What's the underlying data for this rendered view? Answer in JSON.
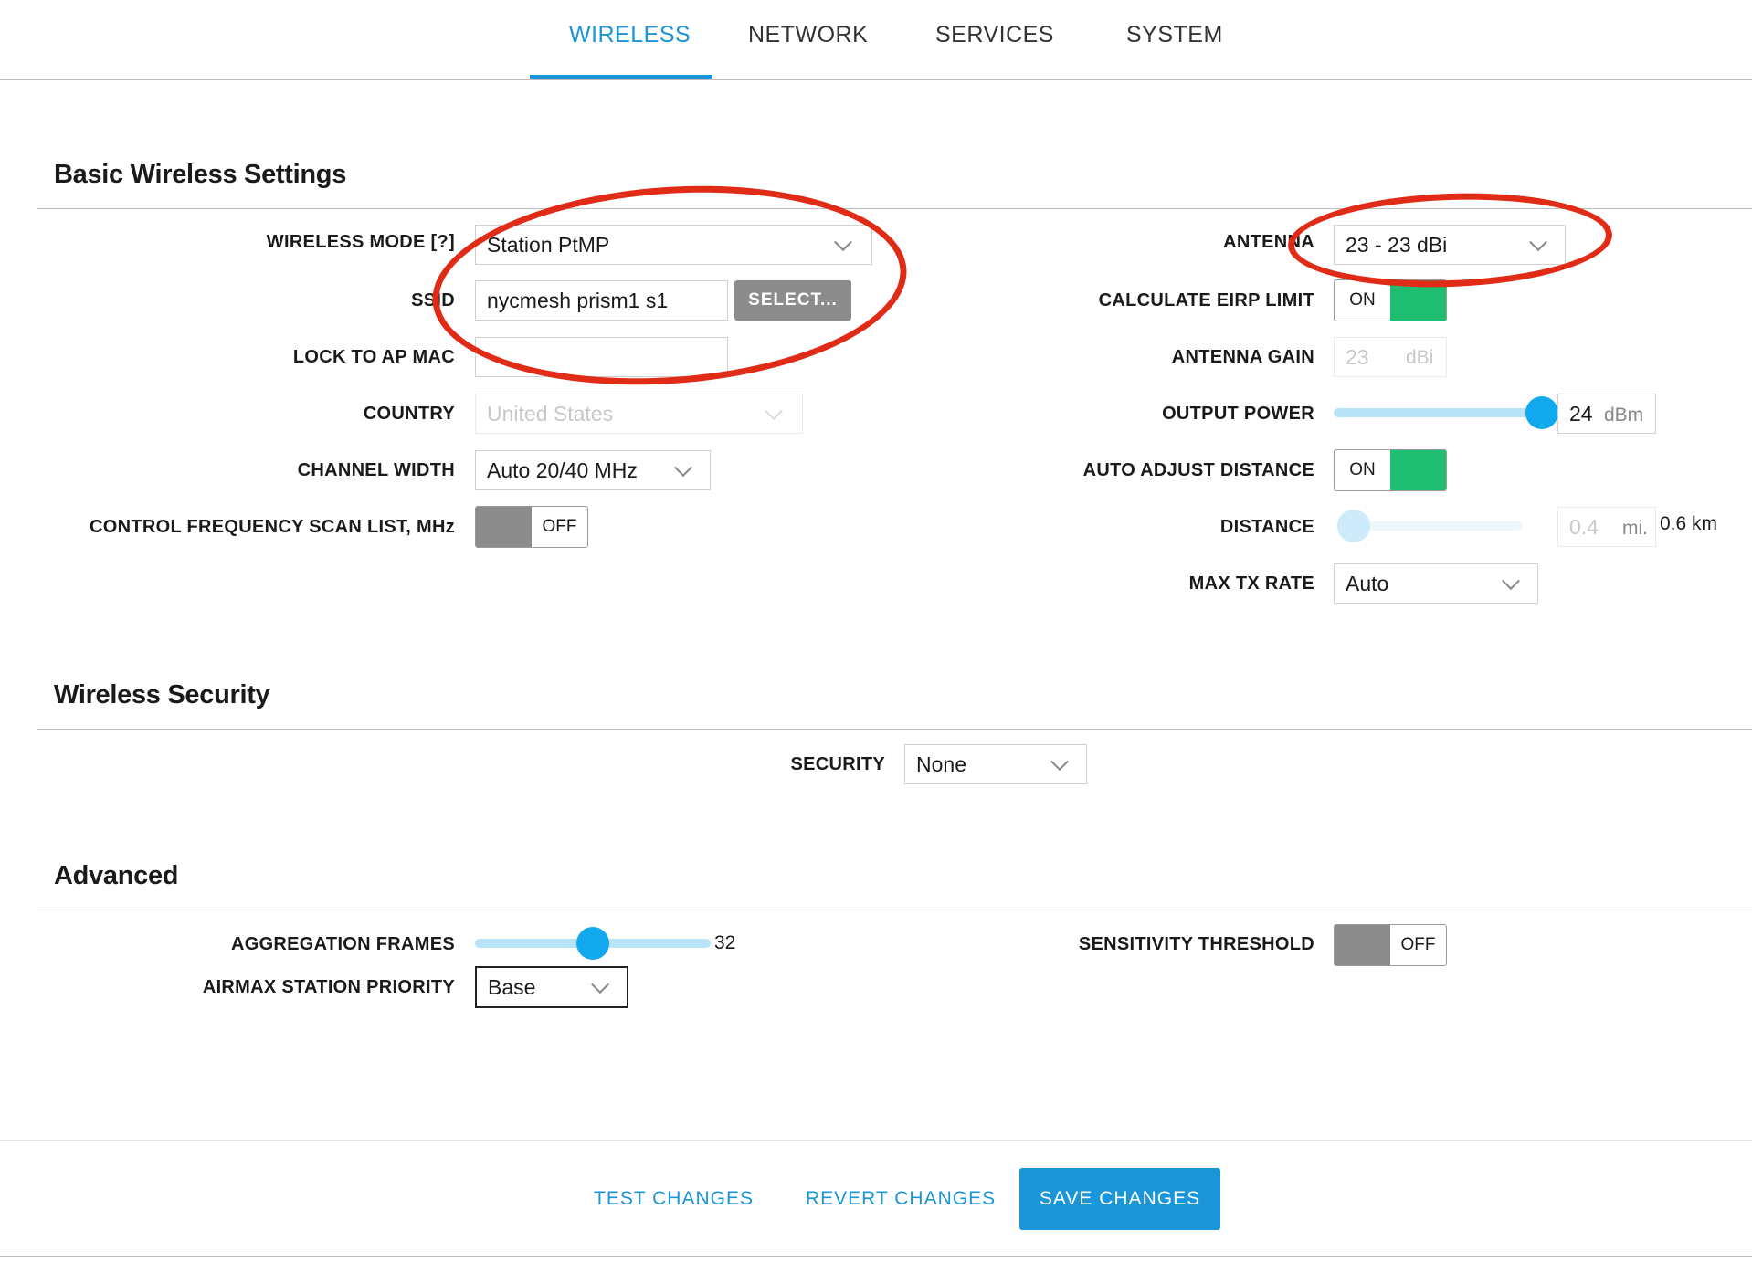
{
  "tabs": [
    {
      "label": "WIRELESS",
      "active": true
    },
    {
      "label": "NETWORK",
      "active": false
    },
    {
      "label": "SERVICES",
      "active": false
    },
    {
      "label": "SYSTEM",
      "active": false
    }
  ],
  "basic": {
    "title": "Basic Wireless Settings",
    "wireless_mode": {
      "label": "WIRELESS MODE [?]",
      "value": "Station PtMP"
    },
    "ssid": {
      "label": "SSID",
      "value": "nycmesh prism1 s1",
      "select_label": "SELECT..."
    },
    "lock_mac": {
      "label": "LOCK TO AP MAC",
      "value": ""
    },
    "country": {
      "label": "COUNTRY",
      "value": "United States"
    },
    "channel_width": {
      "label": "CHANNEL WIDTH",
      "value": "Auto 20/40 MHz"
    },
    "scan_list": {
      "label": "CONTROL FREQUENCY SCAN LIST, MHz",
      "state": "OFF"
    },
    "antenna": {
      "label": "ANTENNA",
      "value": "23 - 23 dBi"
    },
    "eirp": {
      "label": "CALCULATE EIRP LIMIT",
      "state": "ON"
    },
    "antenna_gain": {
      "label": "ANTENNA GAIN",
      "value": "23",
      "unit": "dBi"
    },
    "output_power": {
      "label": "OUTPUT POWER",
      "value": "24",
      "unit": "dBm",
      "level": 1.0
    },
    "auto_distance": {
      "label": "AUTO ADJUST DISTANCE",
      "state": "ON"
    },
    "distance": {
      "label": "DISTANCE",
      "value": "0.4",
      "unit": "mi.",
      "km": "0.6 km",
      "level": 0.0
    },
    "max_tx": {
      "label": "MAX TX RATE",
      "value": "Auto"
    }
  },
  "security": {
    "title": "Wireless Security",
    "label": "SECURITY",
    "value": "None"
  },
  "advanced": {
    "title": "Advanced",
    "aggregation": {
      "label": "AGGREGATION FRAMES",
      "value": "32",
      "level": 0.5
    },
    "airmax": {
      "label": "AIRMAX STATION PRIORITY",
      "value": "Base"
    },
    "sensitivity": {
      "label": "SENSITIVITY THRESHOLD",
      "state": "OFF"
    }
  },
  "footer": {
    "test": "TEST CHANGES",
    "revert": "REVERT CHANGES",
    "save": "SAVE CHANGES"
  },
  "colors": {
    "accent": "#1a95d8",
    "toggle_on": "#1ebd70",
    "annotation": "#e02b17"
  }
}
